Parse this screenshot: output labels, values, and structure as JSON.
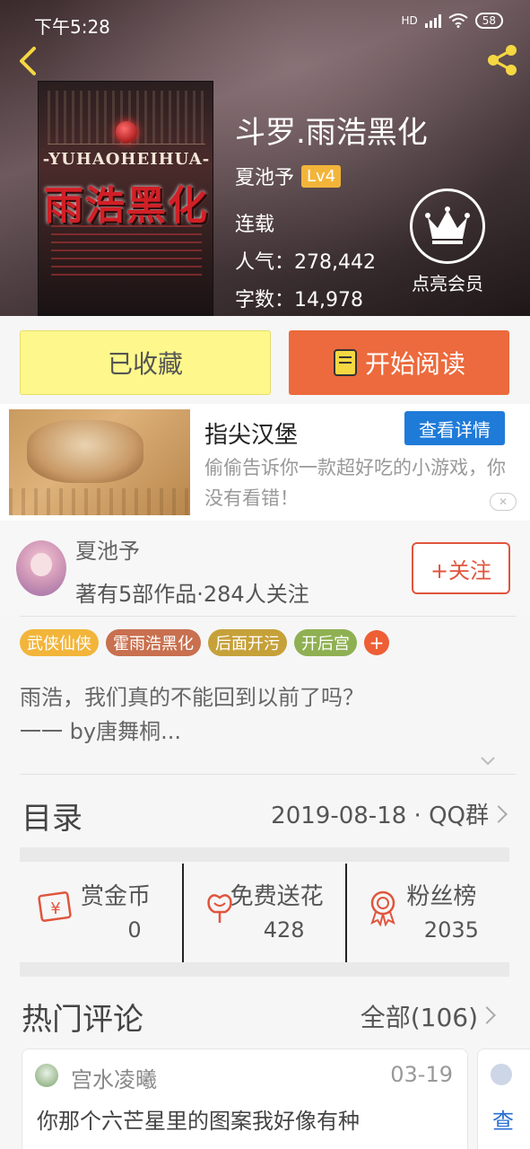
{
  "status_bar": {
    "time": "下午5:28",
    "network": "HD",
    "battery": "58"
  },
  "book": {
    "title": "斗罗.雨浩黑化",
    "author": "夏池予",
    "author_level": "Lv4",
    "status": "连载",
    "popularity": "人气：278,442",
    "word_count": "字数：14,978",
    "cover": {
      "title": "雨浩黑化",
      "subtitle": "-YUHAOHEIHUA-"
    }
  },
  "vip": {
    "label": "点亮会员"
  },
  "actions": {
    "collected_label": "已收藏",
    "read_label": "开始阅读"
  },
  "ad": {
    "title": "指尖汉堡",
    "detail_button": "查看详情",
    "description": "偷偷告诉你一款超好吃的小游戏，你没有看错！",
    "close": "✕"
  },
  "author_card": {
    "name": "夏池予",
    "info": "著有5部作品·284人关注",
    "follow_button": "+关注"
  },
  "tags": [
    {
      "label": "武侠仙侠",
      "color": "#f2b53a"
    },
    {
      "label": "霍雨浩黑化",
      "color": "#c8704f"
    },
    {
      "label": "后面开污",
      "color": "#c6a13a"
    },
    {
      "label": "开后宫",
      "color": "#8fb052"
    }
  ],
  "tag_more": "+",
  "synopsis": {
    "line1": "雨浩，我们真的不能回到以前了吗？",
    "line2": "一一 by唐舞桐..."
  },
  "catalog": {
    "title": "目录",
    "meta": "2019-08-18 · QQ群"
  },
  "stats": [
    {
      "label": "赏金币",
      "value": "0",
      "icon": "gold-coin-icon"
    },
    {
      "label": "免费送花",
      "value": "428",
      "icon": "flower-icon"
    },
    {
      "label": "粉丝榜",
      "value": "2035",
      "icon": "medal-icon"
    }
  ],
  "comments": {
    "title": "热门评论",
    "all_label": "全部(106)",
    "items": [
      {
        "user": "宫水凌曦",
        "date": "03-19",
        "text": "你那个六芒星里的图案我好像有种"
      }
    ],
    "next_preview": "查"
  },
  "colors": {
    "accent_orange": "#ec6a3d",
    "collected_yellow": "#fef88c",
    "link_blue": "#1f7bd8",
    "level_badge": "#f2b53a"
  }
}
